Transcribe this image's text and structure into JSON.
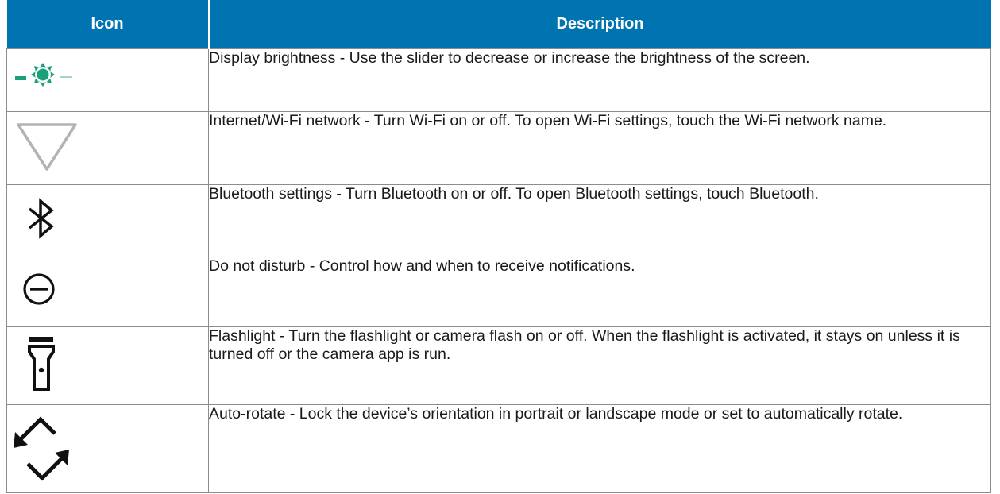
{
  "table": {
    "headers": {
      "icon": "Icon",
      "description": "Description"
    },
    "rows": [
      {
        "icon": "brightness-icon",
        "icon_color": "#18a07a",
        "description": "Display brightness - Use the slider to decrease or increase the brightness of the screen."
      },
      {
        "icon": "wifi-icon",
        "icon_color": "#b3b3b3",
        "description": "Internet/Wi-Fi network - Turn Wi-Fi on or off. To open Wi-Fi settings, touch the Wi-Fi network name."
      },
      {
        "icon": "bluetooth-icon",
        "icon_color": "#111111",
        "description": "Bluetooth settings - Turn Bluetooth on or off. To open Bluetooth settings, touch Bluetooth."
      },
      {
        "icon": "do-not-disturb-icon",
        "icon_color": "#111111",
        "description": "Do not disturb - Control how and when to receive notifications."
      },
      {
        "icon": "flashlight-icon",
        "icon_color": "#111111",
        "description": "Flashlight - Turn the flashlight or camera flash on or off. When the flashlight is activated, it stays on unless it is turned off or the camera app is run."
      },
      {
        "icon": "auto-rotate-icon",
        "icon_color": "#111111",
        "description": "Auto-rotate - Lock the device’s orientation in portrait or landscape mode or set to automatically rotate."
      }
    ]
  },
  "colors": {
    "header_background": "#0073b1",
    "header_text": "#ffffff",
    "border": "#8c8c8c"
  }
}
